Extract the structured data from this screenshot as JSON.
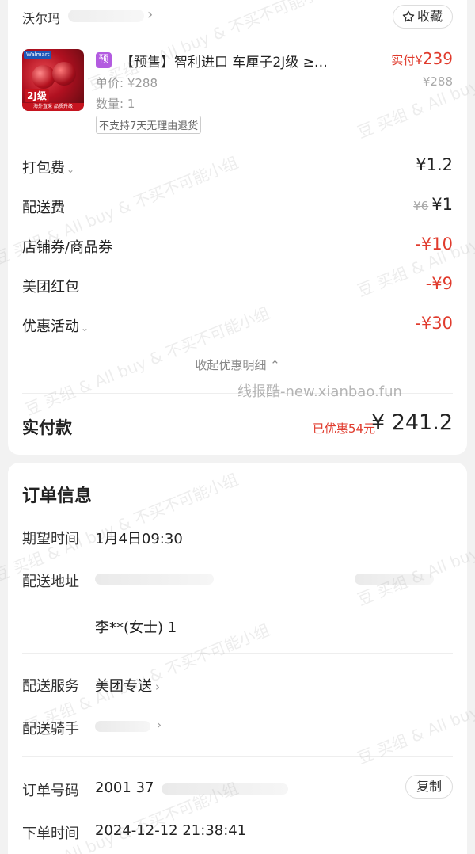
{
  "store": {
    "name": "沃尔玛",
    "favorite_label": "收藏"
  },
  "product": {
    "badge": "预",
    "title": "【预售】智利进口 车厘子2J级 ≥…",
    "paid_prefix": "实付¥",
    "paid_amount": "239",
    "unit_price": "单价: ¥288",
    "original_price": "¥288",
    "quantity": "数量: 1",
    "return_policy": "不支持7天无理由退货",
    "thumb_text": {
      "grade": "2J级",
      "brand": "Walmart",
      "band": "海外直采 品质升级"
    }
  },
  "fees": [
    {
      "label": "打包费",
      "value": "¥1.2",
      "has_chevron": true
    },
    {
      "label": "配送费",
      "value": "¥1",
      "strike": "¥6"
    },
    {
      "label": "店铺券/商品券",
      "value": "-¥10",
      "red": true
    },
    {
      "label": "美团红包",
      "value": "-¥9",
      "red": true
    },
    {
      "label": "优惠活动",
      "value": "-¥30",
      "red": true,
      "has_chevron": true
    }
  ],
  "collapse_label": "收起优惠明细 ⌃",
  "total": {
    "label": "实付款",
    "saved": "已优惠54元",
    "value": "¥ 241.2"
  },
  "order": {
    "title": "订单信息",
    "expected_time_label": "期望时间",
    "expected_time": "1月4日09:30",
    "address_label": "配送地址",
    "address_tail": "李**(女士) 1",
    "service_label": "配送服务",
    "service_value": "美团专送",
    "rider_label": "配送骑手",
    "order_no_label": "订单号码",
    "order_no": "2001 37",
    "copy_label": "复制",
    "order_time_label": "下单时间",
    "order_time": "2024-12-12 21:38:41"
  },
  "watermark": {
    "text": "豆 买组 & All buy & 不买不可能小组",
    "site": "线报酷-new.xianbao.fun"
  },
  "colors": {
    "accent_red": "#e03b2d",
    "badge_purple": "#b35be0"
  }
}
